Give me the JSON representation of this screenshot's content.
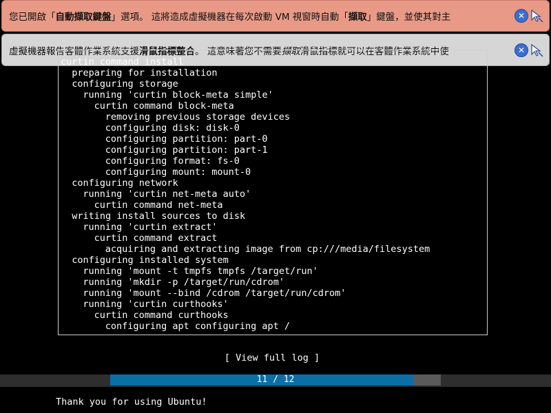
{
  "notifications": [
    {
      "segments": [
        {
          "text": "您已開啟「",
          "bold": false
        },
        {
          "text": "自動擷取鍵盤",
          "bold": true
        },
        {
          "text": "」選項。 這將造成虛擬機器在每次啟動 VM 視窗時自動「",
          "bold": false
        },
        {
          "text": "擷取",
          "bold": true
        },
        {
          "text": "」鍵盤，並使其對主",
          "bold": false
        }
      ],
      "close_icon": "close-icon",
      "secondary_icon": "mouse-capture-icon"
    },
    {
      "segments": [
        {
          "text": "虛擬機器報告客體作業系統支援",
          "bold": false
        },
        {
          "text": "滑鼠指標整合",
          "bold": true
        },
        {
          "text": "。 這意味著您不需要",
          "bold": false
        },
        {
          "text": "擷取",
          "bold": false,
          "italic": true
        },
        {
          "text": "滑鼠指標就可以在客體作業系統中使",
          "bold": false
        }
      ],
      "close_icon": "close-icon",
      "secondary_icon": "mouse-integration-icon"
    }
  ],
  "log": {
    "lines": [
      {
        "indent": 0,
        "text": "curtin command install"
      },
      {
        "indent": 1,
        "text": "preparing for installation"
      },
      {
        "indent": 1,
        "text": "configuring storage"
      },
      {
        "indent": 2,
        "text": "running 'curtin block-meta simple'"
      },
      {
        "indent": 3,
        "text": "curtin command block-meta"
      },
      {
        "indent": 4,
        "text": "removing previous storage devices"
      },
      {
        "indent": 4,
        "text": "configuring disk: disk-0"
      },
      {
        "indent": 4,
        "text": "configuring partition: part-0"
      },
      {
        "indent": 4,
        "text": "configuring partition: part-1"
      },
      {
        "indent": 4,
        "text": "configuring format: fs-0"
      },
      {
        "indent": 4,
        "text": "configuring mount: mount-0"
      },
      {
        "indent": 1,
        "text": "configuring network"
      },
      {
        "indent": 2,
        "text": "running 'curtin net-meta auto'"
      },
      {
        "indent": 3,
        "text": "curtin command net-meta"
      },
      {
        "indent": 1,
        "text": "writing install sources to disk"
      },
      {
        "indent": 2,
        "text": "running 'curtin extract'"
      },
      {
        "indent": 3,
        "text": "curtin command extract"
      },
      {
        "indent": 4,
        "text": "acquiring and extracting image from cp:///media/filesystem"
      },
      {
        "indent": 1,
        "text": "configuring installed system"
      },
      {
        "indent": 2,
        "text": "running 'mount -t tmpfs tmpfs /target/run'"
      },
      {
        "indent": 2,
        "text": "running 'mkdir -p /target/run/cdrom'"
      },
      {
        "indent": 2,
        "text": "running 'mount --bind /cdrom /target/run/cdrom'"
      },
      {
        "indent": 2,
        "text": "running 'curtin curthooks'"
      },
      {
        "indent": 3,
        "text": "curtin command curthooks"
      },
      {
        "indent": 4,
        "text": "configuring apt configuring apt /"
      }
    ]
  },
  "view_full_log_label": "[ View full log ]",
  "progress": {
    "current": 11,
    "total": 12,
    "text": "11 / 12",
    "fraction": 0.917
  },
  "footer_text": "Thank you for using Ubuntu!",
  "colors": {
    "notification_warning_bg": "#e99a86",
    "notification_info_bg": "#d6d6d6",
    "progress_fill": "#0a6fa6",
    "progress_track": "#5a5a5a",
    "terminal_bg": "#000000"
  }
}
